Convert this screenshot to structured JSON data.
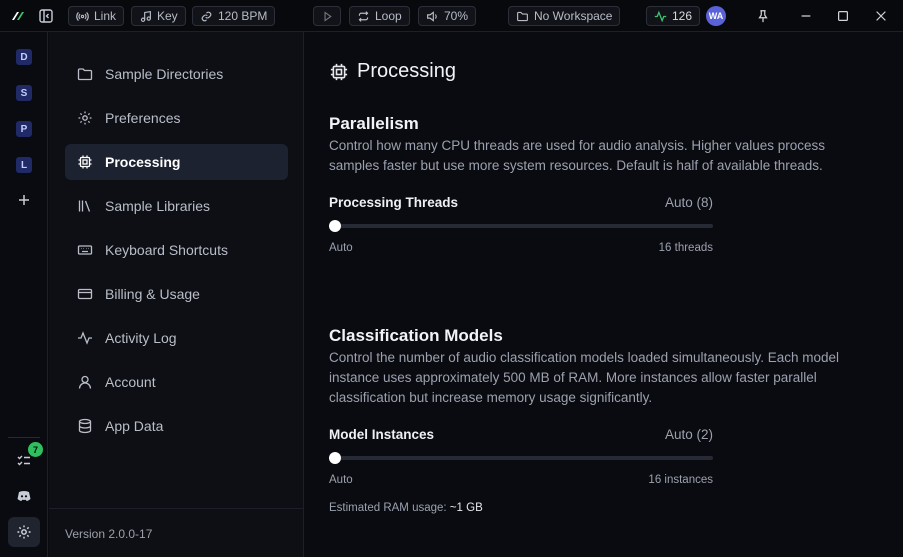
{
  "titlebar": {
    "link_label": "Link",
    "key_label": "Key",
    "bpm_label": "120 BPM",
    "loop_label": "Loop",
    "volume_label": "70%",
    "workspace_label": "No Workspace",
    "activity_count": "126",
    "avatar_initials": "WA"
  },
  "rail": {
    "workspaces": [
      "D",
      "S",
      "P",
      "L"
    ],
    "notification_count": "7"
  },
  "nav": {
    "items": [
      {
        "label": "Sample Directories",
        "icon": "folder-icon"
      },
      {
        "label": "Preferences",
        "icon": "gear-icon"
      },
      {
        "label": "Processing",
        "icon": "cpu-icon"
      },
      {
        "label": "Sample Libraries",
        "icon": "library-icon"
      },
      {
        "label": "Keyboard Shortcuts",
        "icon": "keyboard-icon"
      },
      {
        "label": "Billing & Usage",
        "icon": "credit-card-icon"
      },
      {
        "label": "Activity Log",
        "icon": "activity-icon"
      },
      {
        "label": "Account",
        "icon": "user-icon"
      },
      {
        "label": "App Data",
        "icon": "database-icon"
      }
    ],
    "active_index": 2,
    "version": "Version 2.0.0-17"
  },
  "main": {
    "title": "Processing",
    "parallelism": {
      "title": "Parallelism",
      "description": "Control how many CPU threads are used for audio analysis. Higher values process samples faster but use more system resources. Default is half of available threads.",
      "setting_label": "Processing Threads",
      "value": "Auto (8)",
      "min_label": "Auto",
      "max_label": "16 threads",
      "slider_position": 0
    },
    "classification": {
      "title": "Classification Models",
      "description": "Control the number of audio classification models loaded simultaneously. Each model instance uses approximately 500 MB of RAM. More instances allow faster parallel classification but increase memory usage significantly.",
      "setting_label": "Model Instances",
      "value": "Auto (2)",
      "min_label": "Auto",
      "max_label": "16 instances",
      "slider_position": 0,
      "ram_label": "Estimated RAM usage:",
      "ram_value": "~1 GB"
    }
  },
  "colors": {
    "accent": "#5a62d8",
    "success": "#2fbf5f",
    "active_nav": "#1d2230"
  }
}
